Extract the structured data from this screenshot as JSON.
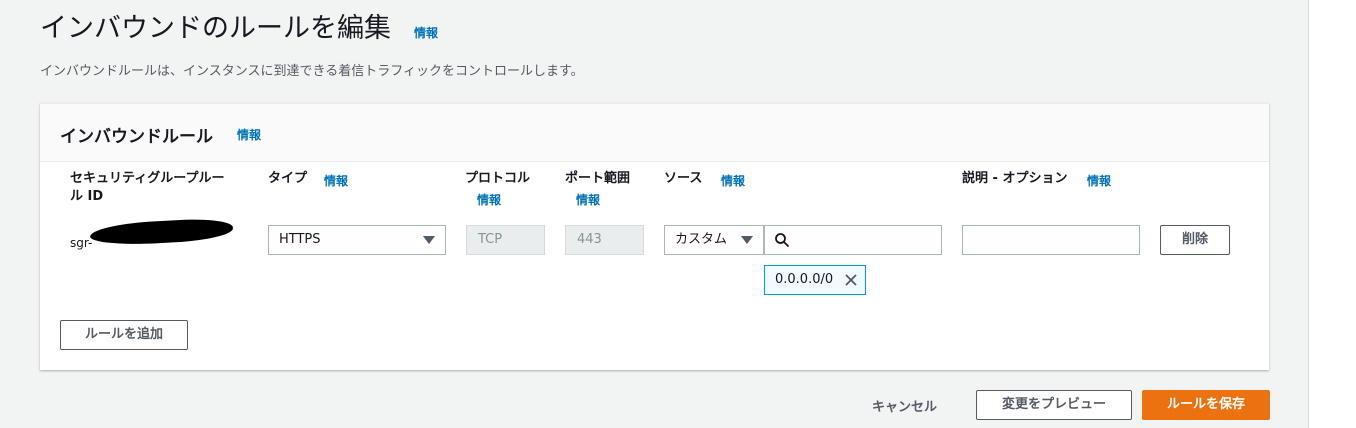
{
  "header": {
    "title": "インバウンドのルールを編集",
    "info": "情報",
    "description": "インバウンドルールは、インスタンスに到達できる着信トラフィックをコントロールします。"
  },
  "panel": {
    "title": "インバウンドルール",
    "info": "情報",
    "columns": {
      "rule_id": "セキュリティグループルール ID",
      "rule_id_line1": "セキュリティグループルー",
      "rule_id_line2": "ル ID",
      "type": "タイプ",
      "protocol": "プロトコル",
      "port_range": "ポート範囲",
      "source": "ソース",
      "description": "説明 - オプション",
      "info": "情報"
    },
    "row": {
      "rule_id": "sgr-",
      "type": "HTTPS",
      "protocol": "TCP",
      "port": "443",
      "source_type": "カスタム",
      "source_search_value": "",
      "source_token": "0.0.0.0/0",
      "description_value": "",
      "delete_label": "削除"
    },
    "add_rule_label": "ルールを追加"
  },
  "footer": {
    "cancel_label": "キャンセル",
    "preview_label": "変更をプレビュー",
    "save_label": "ルールを保存"
  },
  "colors": {
    "primary_button": "#ec7211",
    "link": "#0073bb",
    "token_border": "#00a1c9"
  },
  "icons": {
    "type_dropdown": "caret-down-icon",
    "source_dropdown": "caret-down-icon",
    "search": "search-icon",
    "token_remove": "close-icon"
  }
}
